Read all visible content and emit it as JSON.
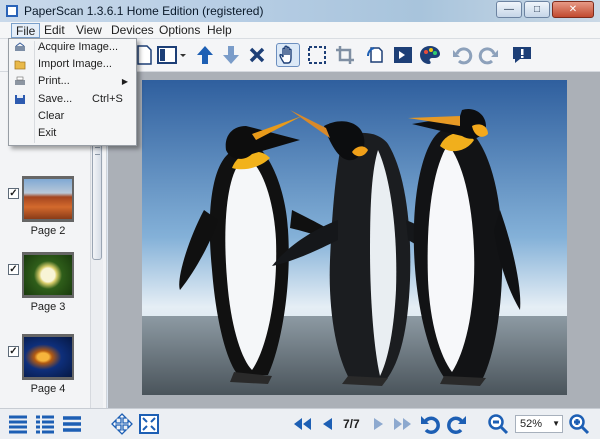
{
  "window": {
    "title": "PaperScan 1.3.6.1 Home Edition (registered)"
  },
  "menu": [
    "File",
    "Edit",
    "View",
    "Devices",
    "Options",
    "Help"
  ],
  "file_menu": {
    "items": [
      {
        "label": "Acquire Image...",
        "shortcut": "",
        "icon": "scanner-icon"
      },
      {
        "label": "Import Image...",
        "shortcut": "",
        "icon": "folder-open-icon"
      },
      {
        "label": "Print...",
        "shortcut": "",
        "icon": "printer-icon",
        "submenu": true
      },
      {
        "label": "Save...",
        "shortcut": "Ctrl+S",
        "icon": "floppy-disk-icon"
      },
      {
        "label": "Clear",
        "shortcut": ""
      },
      {
        "label": "Exit",
        "shortcut": ""
      }
    ]
  },
  "thumbnails": [
    {
      "caption": "Page 2",
      "checked": true
    },
    {
      "caption": "Page 3",
      "checked": true
    },
    {
      "caption": "Page 4",
      "checked": true
    }
  ],
  "navigation": {
    "page_indicator": "7/7"
  },
  "zoom": {
    "value": "52%"
  },
  "colors": {
    "accent": "#1d5fb4",
    "background": "#abb0b7",
    "menu_highlight": "#e5eef8"
  }
}
